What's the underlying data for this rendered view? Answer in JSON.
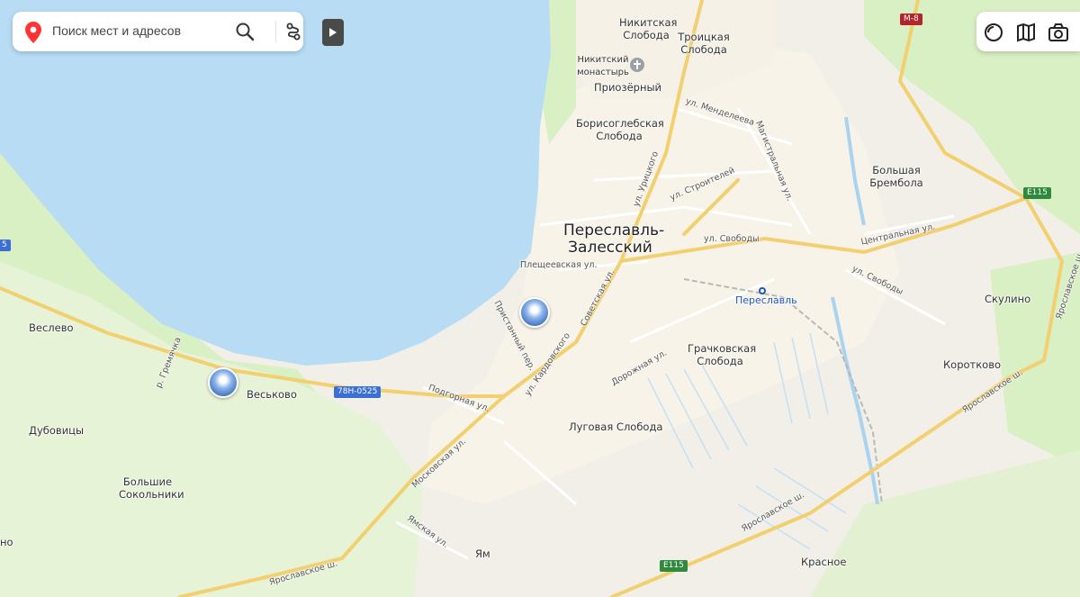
{
  "search": {
    "placeholder": "Поиск мест и адресов"
  },
  "colors": {
    "water": "#b7dcf4",
    "forest": "#d9efc4",
    "urban": "#f7f3e8",
    "major_road": "#f2cf6f",
    "minor_road": "#ffffff",
    "land": "#f1efe8"
  },
  "toolbar": {
    "icons": [
      "layers-icon",
      "map-view-icon",
      "panorama-icon"
    ]
  },
  "labels": {
    "nikitskaya_sloboda": "Никитская\nСлобода",
    "troitskaya_sloboda": "Троицкая\nСлобода",
    "nikitsky_monastery": "Никитский\nмонастырь",
    "priozerny": "Приозёрный",
    "borisoglebskaya_sloboda": "Борисоглебская\nСлобода",
    "bolshaya_brembola": "Большая\nБрембола",
    "pereslavl_zalessky": "Переславль-\nЗалесский",
    "veslevo": "Веслево",
    "veskovo": "Веськово",
    "dubovitsy": "Дубовицы",
    "bolshie_sokolniki": "Большие\nСокольники",
    "grachkovskaya_sloboda": "Грачковская\nСлобода",
    "lugovaya_sloboda": "Луговая Слобода",
    "skulino": "Скулино",
    "korotkovo": "Коротково",
    "krasnoe": "Красное",
    "yam": "Ям",
    "edge_no": "но",
    "pereslavl_station": "Переславль"
  },
  "streets": {
    "menedeleeva": "ул. Менделеева",
    "magistralnaya": "Магистральная ул.",
    "uritskogo": "ул. Урицкого",
    "stroiteley": "ул. Строителей",
    "svobody_1": "ул. Свободы",
    "svobody_2": "ул. Свободы",
    "tsentralnaya": "Центральная ул.",
    "pleshcheevskaya": "Плещеевская ул.",
    "sovetskaya": "Советская ул.",
    "pristanny": "Пристанный пер.",
    "kardovskogo": "ул. Кардовского",
    "dorozhnaya": "Дорожная ул.",
    "podgornaya": "Подгорная ул.",
    "moskovskaya": "Московская ул.",
    "yamskaya": "Ямская ул.",
    "yaroslavskoe_1": "Ярославское ш.",
    "yaroslavskoe_2": "Ярославское ш.",
    "yaroslavskoe_3": "Ярославское ш.",
    "gremyachka": "р. Гремячка"
  },
  "shields": {
    "m8": "M-8",
    "e115_1": "E115",
    "e115_2": "E115",
    "r78": "78Н-0525",
    "edge_5": "5"
  }
}
